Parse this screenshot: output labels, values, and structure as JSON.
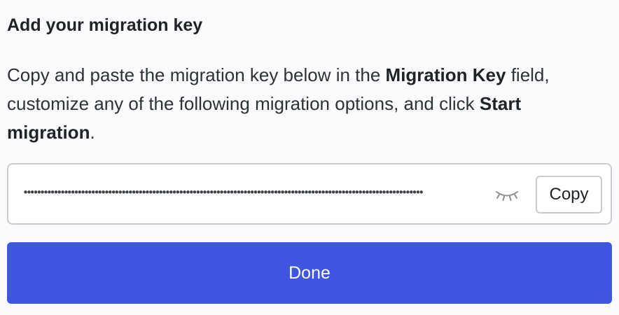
{
  "dialog": {
    "heading": "Add your migration key",
    "description": {
      "part1": "Copy and paste the migration key below in the ",
      "bold1": "Migration Key",
      "part2": " field, customize any of the following migration options, and click ",
      "bold2": "Start migration",
      "part3": "."
    }
  },
  "key_field": {
    "masked_value": "••••••••••••••••••••••••••••••••••••••••••••••••••••••••••••••••••••••••••••••••••••••••••••••••••••••••••••••••••••••",
    "toggle_icon": "eye-closed-icon",
    "copy_label": "Copy"
  },
  "actions": {
    "done_label": "Done"
  },
  "colors": {
    "primary": "#3f57e0",
    "border": "#c8cbd0",
    "text": "#1e2327"
  }
}
